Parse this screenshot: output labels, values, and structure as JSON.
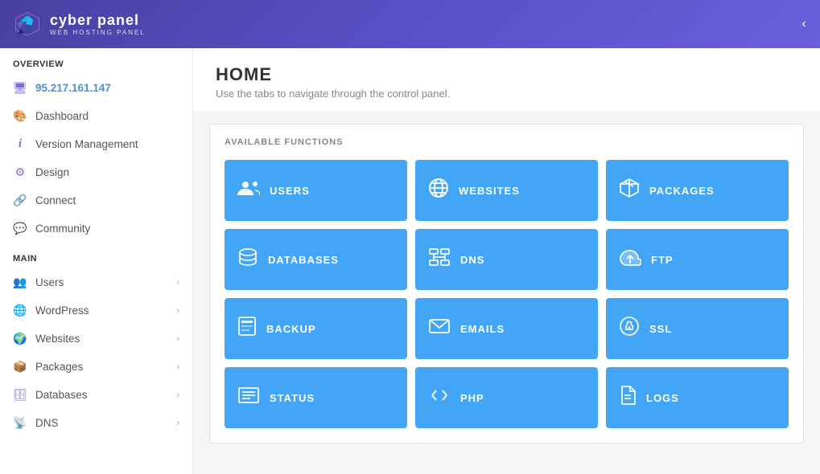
{
  "header": {
    "logo_main": "cyber panel",
    "logo_sub": "WEB HOSTING PANEL",
    "toggle_icon": "‹"
  },
  "sidebar": {
    "overview_title": "OVERVIEW",
    "server_ip": "95.217.161.147",
    "overview_items": [
      {
        "id": "dashboard",
        "label": "Dashboard",
        "icon": "🎨"
      },
      {
        "id": "version-management",
        "label": "Version Management",
        "icon": "ℹ"
      },
      {
        "id": "design",
        "label": "Design",
        "icon": "⚙"
      },
      {
        "id": "connect",
        "label": "Connect",
        "icon": "🔗"
      },
      {
        "id": "community",
        "label": "Community",
        "icon": "💬"
      }
    ],
    "main_title": "MAIN",
    "main_items": [
      {
        "id": "users",
        "label": "Users",
        "icon": "👥",
        "has_arrow": true
      },
      {
        "id": "wordpress",
        "label": "WordPress",
        "icon": "🌐",
        "has_arrow": true
      },
      {
        "id": "websites",
        "label": "Websites",
        "icon": "🌍",
        "has_arrow": true
      },
      {
        "id": "packages",
        "label": "Packages",
        "icon": "📦",
        "has_arrow": true
      },
      {
        "id": "databases",
        "label": "Databases",
        "icon": "🗄",
        "has_arrow": true
      },
      {
        "id": "dns",
        "label": "DNS",
        "icon": "📡",
        "has_arrow": true
      }
    ]
  },
  "content": {
    "title": "HOME",
    "subtitle": "Use the tabs to navigate through the control panel.",
    "functions_title": "AVAILABLE FUNCTIONS",
    "functions": [
      {
        "id": "users",
        "label": "USERS",
        "icon": "👥"
      },
      {
        "id": "websites",
        "label": "WEBSITES",
        "icon": "🌐"
      },
      {
        "id": "packages",
        "label": "PACKAGES",
        "icon": "📦"
      },
      {
        "id": "databases",
        "label": "DATABASES",
        "icon": "🗄"
      },
      {
        "id": "dns",
        "label": "DNS",
        "icon": "📊"
      },
      {
        "id": "ftp",
        "label": "FTP",
        "icon": "☁"
      },
      {
        "id": "backup",
        "label": "BACKUP",
        "icon": "📋"
      },
      {
        "id": "emails",
        "label": "EMAILS",
        "icon": "✉"
      },
      {
        "id": "ssl",
        "label": "SSL",
        "icon": "🔒"
      },
      {
        "id": "status",
        "label": "STATUS",
        "icon": "📜"
      },
      {
        "id": "php",
        "label": "PHP",
        "icon": "⟨/⟩"
      },
      {
        "id": "logs",
        "label": "LOGS",
        "icon": "📄"
      }
    ]
  }
}
